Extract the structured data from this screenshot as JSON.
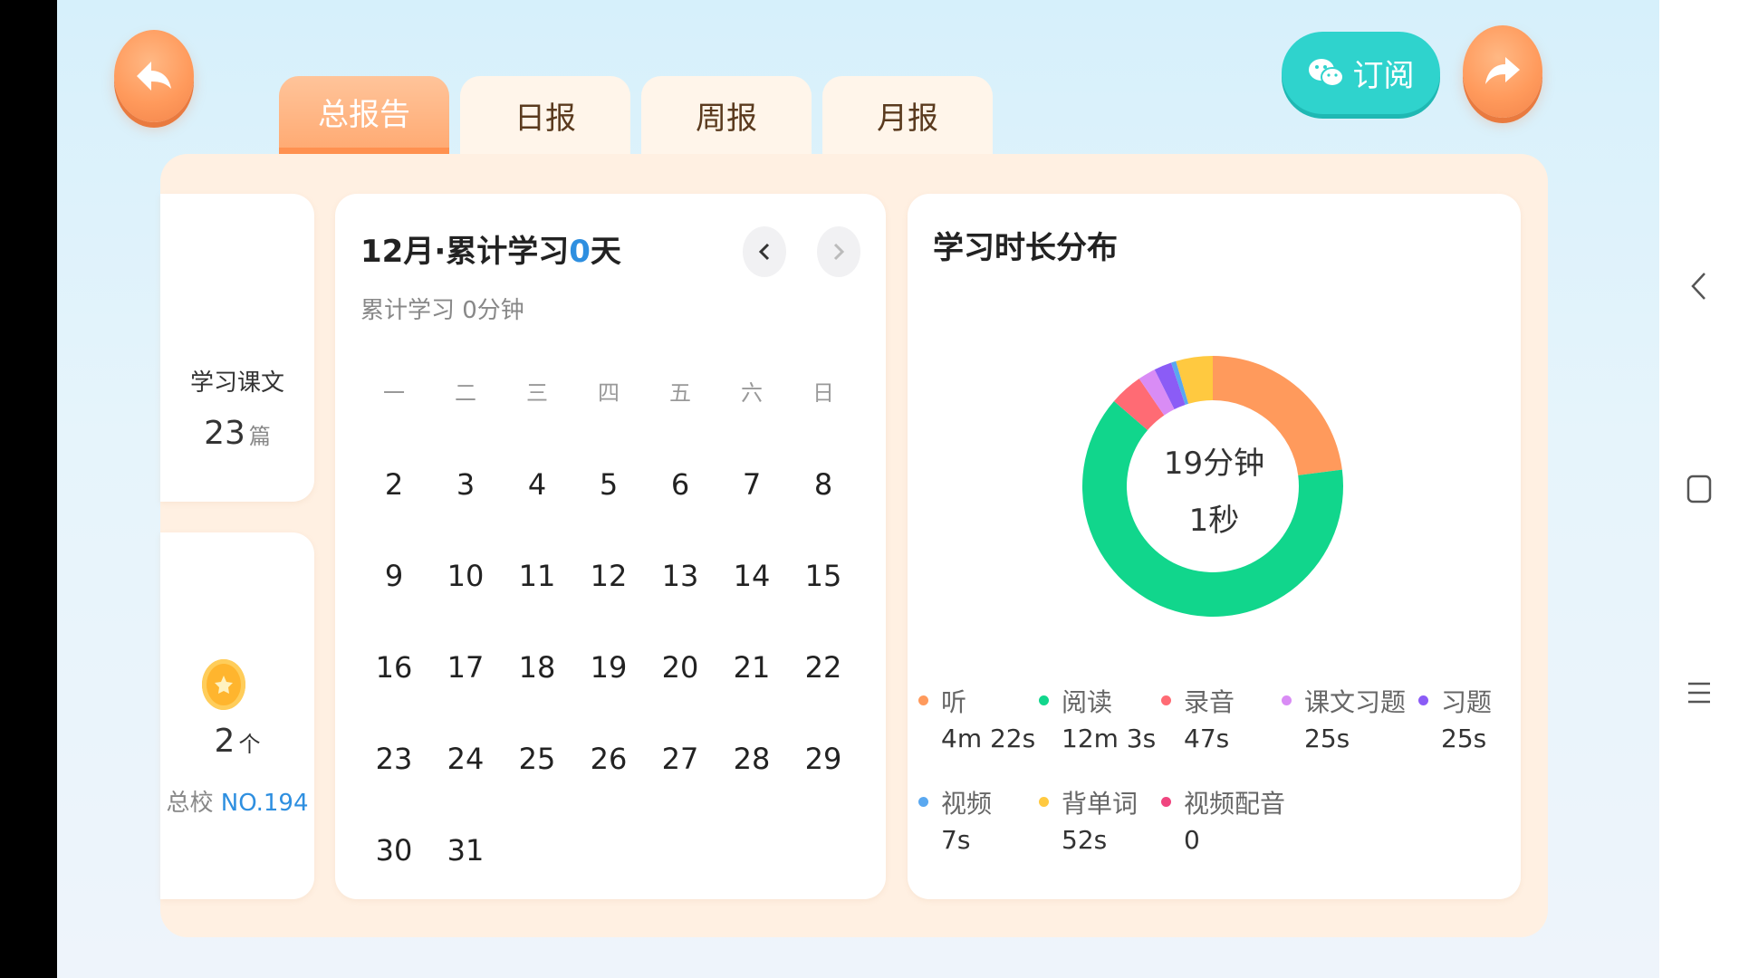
{
  "colors": {
    "accent_orange": "#ff9a5c",
    "subscribe_teal": "#2fd3cd",
    "highlight_blue": "#2e8fe0"
  },
  "header": {
    "subscribe_label": "订阅",
    "tabs": [
      {
        "label": "总报告",
        "active": true
      },
      {
        "label": "日报",
        "active": false
      },
      {
        "label": "周报",
        "active": false
      },
      {
        "label": "月报",
        "active": false
      }
    ]
  },
  "stats": {
    "lessons_label": "学习课文",
    "lessons_count": "23",
    "lessons_unit": "篇",
    "coins_count": "2",
    "coins_unit": "个",
    "rank_prefix": "总校",
    "rank_value": "NO.194"
  },
  "calendar": {
    "title_prefix": "12月·累计学习",
    "title_days": "0",
    "title_suffix": "天",
    "subtitle": "累计学习 0分钟",
    "weekdays": [
      "一",
      "二",
      "三",
      "四",
      "五",
      "六",
      "日"
    ],
    "weeks": [
      [
        "2",
        "3",
        "4",
        "5",
        "6",
        "7",
        "8"
      ],
      [
        "9",
        "10",
        "11",
        "12",
        "13",
        "14",
        "15"
      ],
      [
        "16",
        "17",
        "18",
        "19",
        "20",
        "21",
        "22"
      ],
      [
        "23",
        "24",
        "25",
        "26",
        "27",
        "28",
        "29"
      ],
      [
        "30",
        "31"
      ]
    ]
  },
  "distribution": {
    "title": "学习时长分布",
    "center_line1": "19分钟",
    "center_line2": "1秒",
    "legend": [
      {
        "name": "听",
        "value": "4m 22s",
        "color": "#ff9a5c"
      },
      {
        "name": "阅读",
        "value": "12m 3s",
        "color": "#11d68c"
      },
      {
        "name": "录音",
        "value": "47s",
        "color": "#ff6b74"
      },
      {
        "name": "课文习题",
        "value": "25s",
        "color": "#d98cf5"
      },
      {
        "name": "习题",
        "value": "25s",
        "color": "#8b5cf6"
      },
      {
        "name": "视频",
        "value": "7s",
        "color": "#5aa8f0"
      },
      {
        "name": "背单词",
        "value": "52s",
        "color": "#ffc940"
      },
      {
        "name": "视频配音",
        "value": "0",
        "color": "#f0457f"
      }
    ]
  },
  "chart_data": {
    "type": "pie",
    "categories": [
      "听",
      "阅读",
      "录音",
      "课文习题",
      "习题",
      "视频",
      "背单词",
      "视频配音"
    ],
    "values": [
      262,
      723,
      47,
      25,
      25,
      7,
      52,
      0
    ],
    "unit": "seconds",
    "title": "学习时长分布"
  }
}
